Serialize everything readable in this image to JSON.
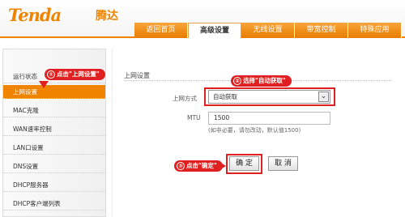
{
  "header": {
    "logo_text": "Tenda",
    "logo_cn": "腾达",
    "tabs": [
      {
        "label": "返回首页"
      },
      {
        "label": "高级设置"
      },
      {
        "label": "无线设置"
      },
      {
        "label": "带宽控制"
      },
      {
        "label": "特殊应用"
      }
    ],
    "active_tab": "高级设置"
  },
  "sidebar": {
    "items": [
      {
        "label": "运行状态"
      },
      {
        "label": "上网设置"
      },
      {
        "label": "MAC克隆"
      },
      {
        "label": "WAN速率控制"
      },
      {
        "label": "LAN口设置"
      },
      {
        "label": "DNS设置"
      },
      {
        "label": "DHCP服务器"
      },
      {
        "label": "DHCP客户端列表"
      }
    ],
    "active_item": "上网设置"
  },
  "form": {
    "section_title": "上网设置",
    "connection_label": "上网方式",
    "connection_value": "自动获取",
    "mtu_label": "MTU",
    "mtu_value": "1500",
    "mtu_hint": "(如非必要，请勿改动，默认值1500)",
    "confirm_label": "确 定",
    "cancel_label": "取 消"
  },
  "annotations": [
    {
      "num": "①",
      "text": "点击\"上网设置\""
    },
    {
      "num": "②",
      "text": "选择\"自动获取\""
    },
    {
      "num": "③",
      "text": "点击\"确定\""
    }
  ],
  "colors": {
    "brand_orange": "#f08300",
    "annotation_red": "#e02020"
  }
}
